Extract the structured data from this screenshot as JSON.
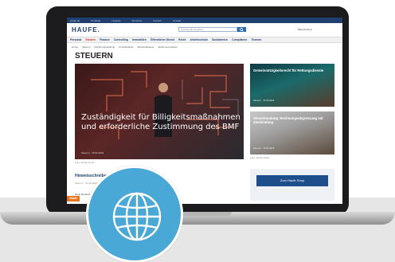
{
  "topbar": {
    "items": [
      "Haufe.de",
      "Produkte",
      "Lexware",
      "Seminare",
      "Karriere",
      "Kontakt"
    ]
  },
  "header": {
    "logo": "HAUFE.",
    "search_placeholder": "Suchbegriff eingeben",
    "account": "Mein Konto"
  },
  "nav": {
    "items": [
      "Personal",
      "Steuern",
      "Finance",
      "Controlling",
      "Immobilien",
      "Öffentlicher Dienst",
      "Recht",
      "Arbeitsschutz",
      "Sozialwesen",
      "Compliance",
      "Themen"
    ],
    "active_index": 1
  },
  "subnav": {
    "items": [
      "Home",
      "Steuern",
      "Rechnungsstellung",
      "Umsatzsteuer",
      "Erbschaftsteuer",
      "Einkommensteuer"
    ]
  },
  "page": {
    "title": "STEUERN"
  },
  "hero": {
    "headline": "Zuständigkeit für Billigkeitsmaßnahmen und erforderliche Zustimmung des BMF",
    "meta": "Steuern · 15.02.2023",
    "caption": "Foto: Adobe Stock"
  },
  "side_cards": [
    {
      "title": "Gemeinnützigkeitsrecht für Rettungsdienste",
      "meta": "Steuern · 15.02.2023"
    },
    {
      "title": "Steuerberatung: Rechnungsabgrenzung mit Zinsbindung",
      "meta": "Steuern · 15.02.2023"
    }
  ],
  "side_caption": "Foto: Adobe Stock",
  "teaser": {
    "title": "Hinweisschreiben des BMF zum Steuerabzug",
    "meta": "Steuern · 15.02.2023",
    "text": "Neue Rundschreiben zum Steuerabzug bei Vergütungen an ausländische Empfänger."
  },
  "cta": {
    "label": "Zum Haufe Shop"
  },
  "feedback": {
    "label": "Haufe"
  },
  "colors": {
    "brand": "#1f3f6e",
    "active_nav": "#d22b2b",
    "badge": "#4aa8d6",
    "feedback": "#e8771c"
  },
  "icons": {
    "badge": "globe-icon",
    "account": "user-icon"
  }
}
